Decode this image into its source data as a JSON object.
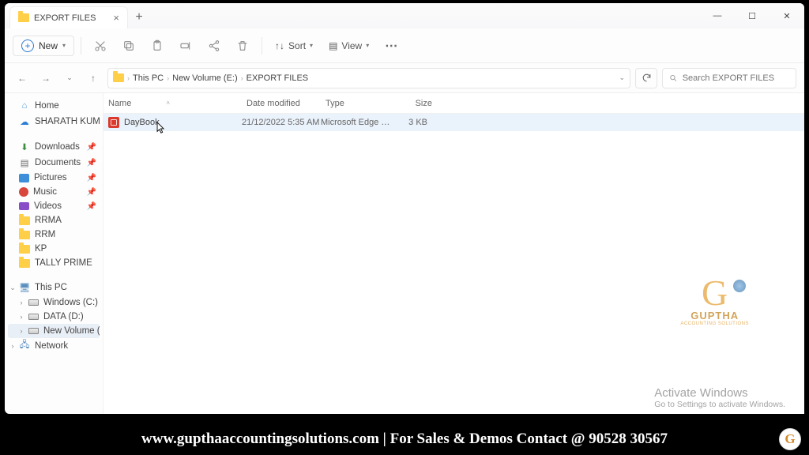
{
  "tab": {
    "title": "EXPORT FILES"
  },
  "toolbar": {
    "new_label": "New",
    "sort_label": "Sort",
    "view_label": "View"
  },
  "breadcrumb": {
    "seg1": "This PC",
    "seg2": "New Volume (E:)",
    "seg3": "EXPORT FILES"
  },
  "search": {
    "placeholder": "Search EXPORT FILES"
  },
  "sidebar": {
    "home": "Home",
    "user": "SHARATH KUMAR",
    "downloads": "Downloads",
    "documents": "Documents",
    "pictures": "Pictures",
    "music": "Music",
    "videos": "Videos",
    "rrma": "RRMA",
    "rrm": "RRM",
    "kp": "KP",
    "tally": "TALLY PRIME",
    "thispc": "This PC",
    "drive_c": "Windows (C:)",
    "drive_d": "DATA (D:)",
    "drive_e": "New Volume (E:)",
    "network": "Network"
  },
  "columns": {
    "name": "Name",
    "date": "Date modified",
    "type": "Type",
    "size": "Size"
  },
  "files": {
    "row0": {
      "name": "DayBook",
      "date": "21/12/2022 5:35 AM",
      "type": "Microsoft Edge PD...",
      "size": "3 KB"
    }
  },
  "watermark": {
    "brand": "GUPTHA",
    "sub": "ACCOUNTING SOLUTIONS"
  },
  "activate": {
    "line1": "Activate Windows",
    "line2": "Go to Settings to activate Windows."
  },
  "footer": {
    "text": "www.gupthaaccountingsolutions.com | For Sales & Demos Contact @ 90528 30567"
  }
}
